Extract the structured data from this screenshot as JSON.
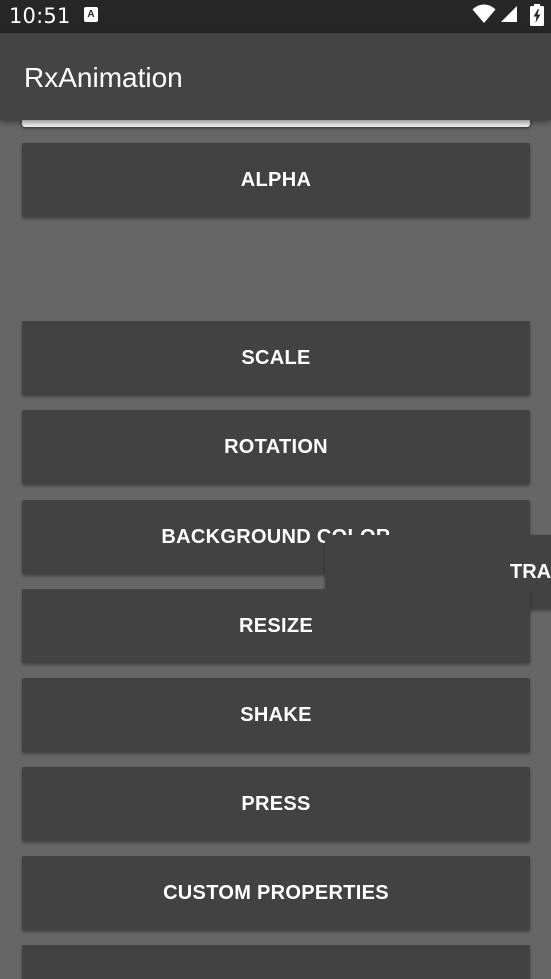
{
  "status_bar": {
    "time": "10:51",
    "notification_icon": "A",
    "icons": [
      "wifi-icon",
      "signal-icon",
      "battery-icon"
    ]
  },
  "app_bar": {
    "title": "RxAnimation"
  },
  "buttons": {
    "alpha": "ALPHA",
    "scale": "SCALE",
    "rotation": "ROTATION",
    "background_color": "BACKGROUND COLOR",
    "translation": "TRAI",
    "resize": "RESIZE",
    "shake": "SHAKE",
    "press": "PRESS",
    "custom_properties": "CUSTOM PROPERTIES"
  },
  "colors": {
    "status_bar": "#262626",
    "app_bar": "#444444",
    "background": "#666666",
    "button": "#424242",
    "text": "#ffffff"
  }
}
